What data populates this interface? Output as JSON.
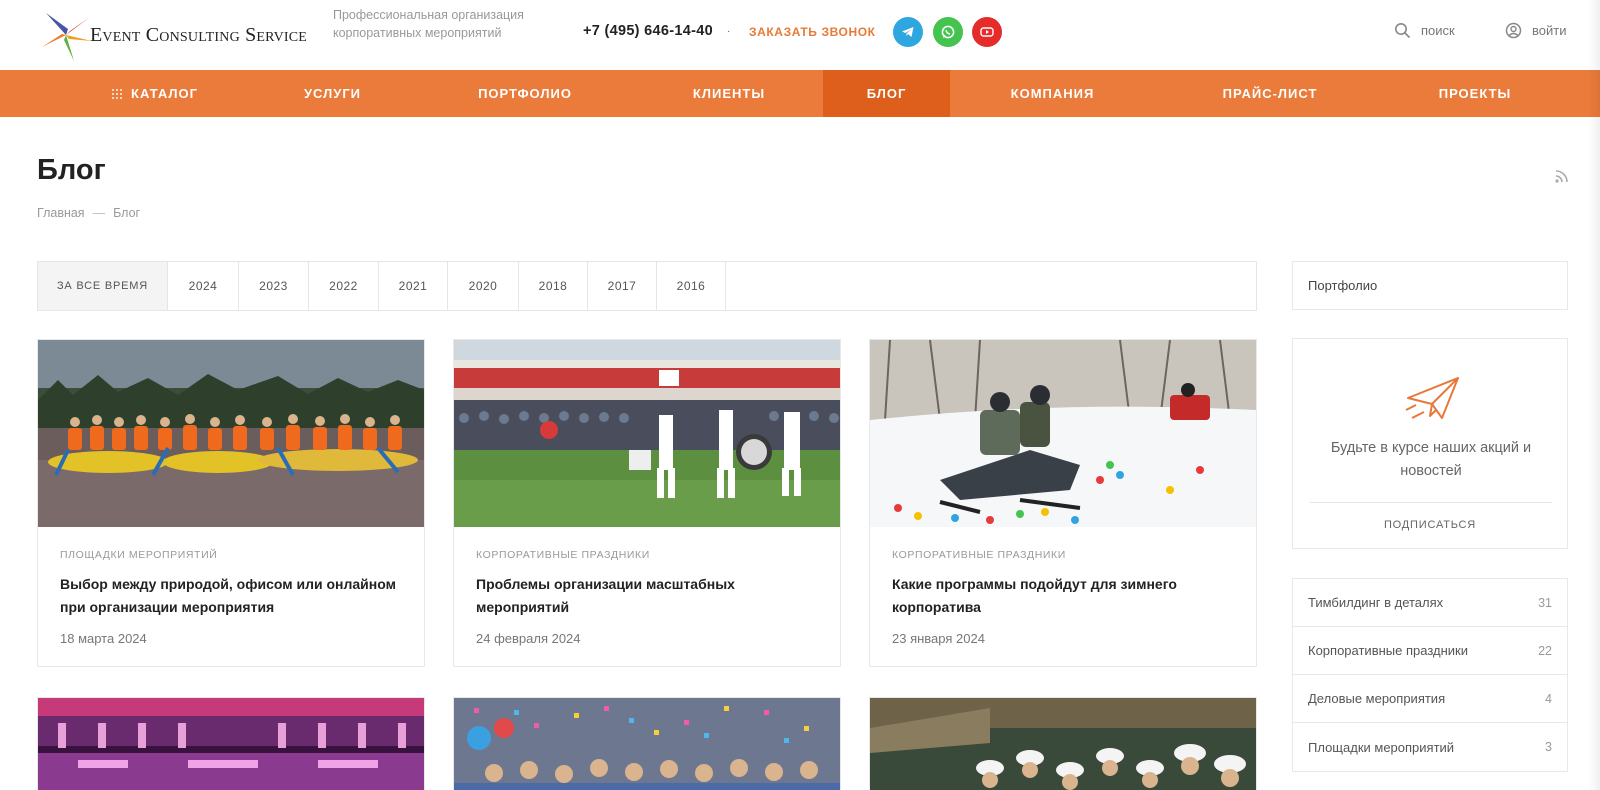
{
  "header": {
    "logo_text": "Event Consulting Service",
    "tagline": "Профессиональная организация корпоративных мероприятий",
    "phone": "+7 (495) 646-14-40",
    "phone_dropdown": "·",
    "callback_label": "Заказать звонок",
    "search_label": "поиск",
    "login_label": "войти"
  },
  "nav": {
    "items": [
      {
        "label": "Каталог"
      },
      {
        "label": "Услуги"
      },
      {
        "label": "Портфолио"
      },
      {
        "label": "Клиенты"
      },
      {
        "label": "Блог"
      },
      {
        "label": "Компания"
      },
      {
        "label": "Прайс-лист"
      },
      {
        "label": "Проекты"
      }
    ],
    "active_index": 4,
    "color": "#ea7b3a",
    "active_color": "#de5f1c"
  },
  "page": {
    "title": "Блог",
    "breadcrumb": {
      "home": "Главная",
      "separator": "—",
      "current": "Блог"
    }
  },
  "years": {
    "items": [
      "За все время",
      "2024",
      "2023",
      "2022",
      "2021",
      "2020",
      "2018",
      "2017",
      "2016"
    ],
    "active_index": 0
  },
  "articles": [
    {
      "category": "Площадки мероприятий",
      "title": "Выбор между природой, офисом или онлайном при организации мероприятия",
      "date": "18 марта 2024",
      "image": "rafting-lake-photo"
    },
    {
      "category": "Корпоративные праздники",
      "title": "Проблемы организации масштабных мероприятий",
      "date": "24 февраля 2024",
      "image": "stadium-drummers-photo"
    },
    {
      "category": "Корпоративные праздники",
      "title": "Какие программы подойдут для зимнего корпоратива",
      "date": "23 января 2024",
      "image": "snowmobile-photo"
    },
    {
      "image": "concert-hall-photo"
    },
    {
      "image": "confetti-crowd-photo"
    },
    {
      "image": "white-caps-crowd-photo"
    }
  ],
  "sidebar": {
    "portfolio_label": "Портфолио",
    "subscribe_text": "Будьте в курсе наших акций и новостей",
    "subscribe_button": "подписаться",
    "categories": [
      {
        "name": "Тимбилдинг в деталях",
        "count": "31"
      },
      {
        "name": "Корпоративные праздники",
        "count": "22"
      },
      {
        "name": "Деловые мероприятия",
        "count": "4"
      },
      {
        "name": "Площадки мероприятий",
        "count": "3"
      }
    ]
  },
  "colors": {
    "accent": "#ea7b3a",
    "telegram": "#2ea6e0",
    "whatsapp": "#45c34f",
    "youtube": "#e62b2b"
  }
}
